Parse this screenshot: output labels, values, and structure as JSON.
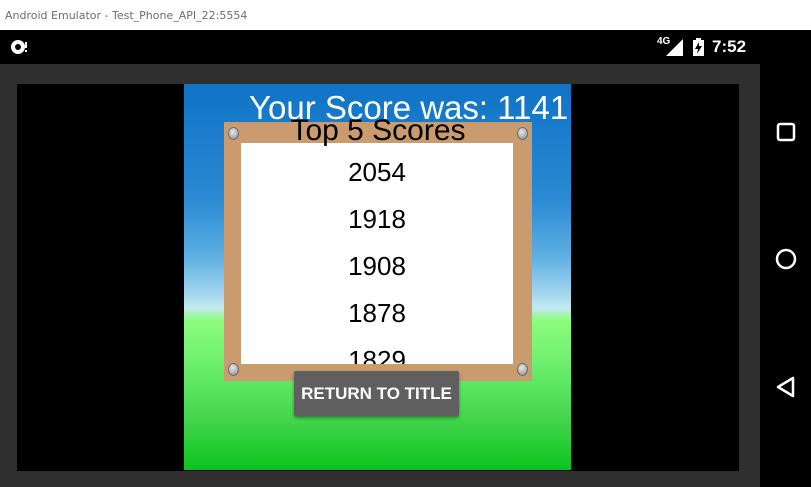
{
  "window": {
    "title": "Android Emulator - Test_Phone_API_22:5554"
  },
  "status_bar": {
    "left_icon": "debug-notification-icon",
    "network_label": "4G",
    "signal_icon": "signal-icon",
    "battery_icon": "battery-charging-icon",
    "time": "7:52"
  },
  "game": {
    "score_text": "Your Score was: 1141",
    "board_title": "Top 5 Scores",
    "top_scores": [
      "2054",
      "1918",
      "1908",
      "1878",
      "1829"
    ],
    "return_button_label": "RETURN TO TITLE"
  },
  "nav_bar": {
    "recents_icon": "square-icon",
    "home_icon": "circle-icon",
    "back_icon": "triangle-back-icon"
  }
}
